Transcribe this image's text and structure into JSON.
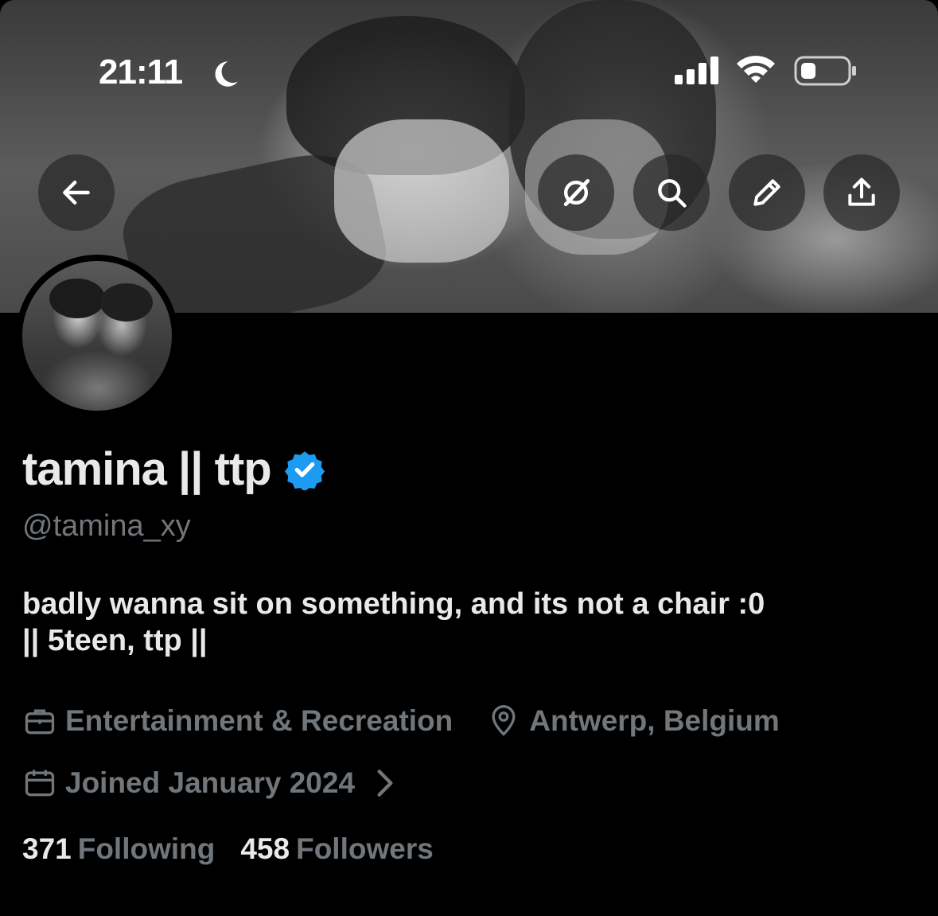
{
  "status_bar": {
    "time": "21:11",
    "icons": [
      "moon-icon",
      "signal-icon",
      "wifi-icon",
      "battery-icon"
    ]
  },
  "header": {
    "buttons": [
      "back-arrow-icon",
      "grok-icon",
      "search-icon",
      "edit-pencil-icon",
      "share-icon"
    ]
  },
  "profile": {
    "display_name": "tamina || ttp",
    "verified": true,
    "verified_color": "#1d9bf0",
    "handle": "@tamina_xy",
    "bio_line1": "badly wanna sit on something, and its not a chair :0",
    "bio_line2": "|| 5teen, ttp ||",
    "category": "Entertainment & Recreation",
    "location": "Antwerp, Belgium",
    "joined": "Joined January 2024",
    "following_count": "371",
    "following_label": "Following",
    "followers_count": "458",
    "followers_label": "Followers"
  },
  "colors": {
    "background": "#000000",
    "text_primary": "#e7e9ea",
    "text_secondary": "#71767b"
  }
}
